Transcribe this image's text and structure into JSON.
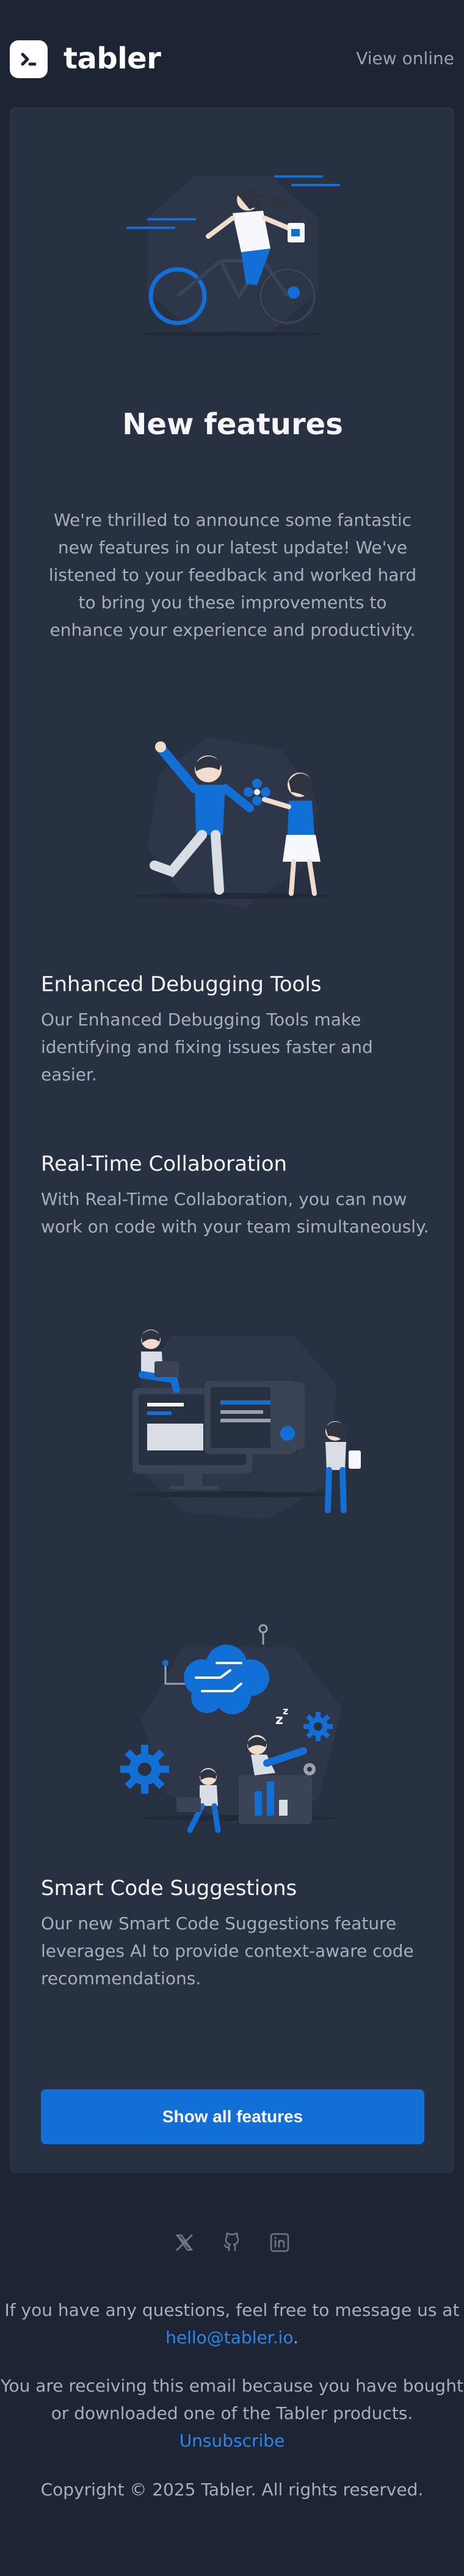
{
  "header": {
    "brand": "tabler",
    "view_online": "View online"
  },
  "hero": {
    "title": "New features",
    "text": "We're thrilled to announce some fantastic new features in our latest update! We've listened to your feedback and worked hard to bring you these improvements to enhance your experience and productivity."
  },
  "features": [
    {
      "title": "Enhanced Debugging Tools",
      "text": "Our Enhanced Debugging Tools make identifying and fixing issues faster and easier."
    },
    {
      "title": "Real-Time Collaboration",
      "text": "With Real-Time Collaboration, you can now work on code with your team simultaneously."
    },
    {
      "title": "Smart Code Suggestions",
      "text": "Our new Smart Code Suggestions feature leverages AI to provide context-aware code recommendations."
    }
  ],
  "cta": {
    "label": "Show all features"
  },
  "footer": {
    "socials": [
      "x-icon",
      "github-icon",
      "linkedin-icon"
    ],
    "questions_text": "If you have any questions, feel free to message us at",
    "email": "hello@tabler.io",
    "period": ".",
    "receiving_text": "You are receiving this email because you have bought or downloaded one of the Tabler products.",
    "unsubscribe": "Unsubscribe",
    "copyright": "Copyright © 2025 Tabler. All rights reserved."
  },
  "colors": {
    "background": "#1d2535",
    "card": "#283142",
    "accent": "#116fd6",
    "link": "#2b86e8",
    "muted_text": "#a7aebb"
  }
}
